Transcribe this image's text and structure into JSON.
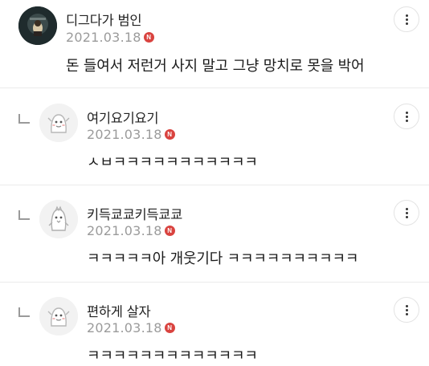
{
  "comments": [
    {
      "nickname": "디그다가 범인",
      "date": "2021.03.18",
      "badge": "N",
      "text": "돈 들여서 저런거 사지 말고 그냥 망치로 못을 박어",
      "avatar_icon": "profile-photo-icon",
      "is_reply": false
    },
    {
      "nickname": "여기요기요기",
      "date": "2021.03.18",
      "badge": "N",
      "text": "ㅅㅂㅋㅋㅋㅋㅋㅋㅋㅋㅋㅋㅋ",
      "avatar_icon": "default-character-icon",
      "is_reply": true
    },
    {
      "nickname": "키득쿄쿄키득쿄쿄",
      "date": "2021.03.18",
      "badge": "N",
      "text": "ㅋㅋㅋㅋㅋ아 개웃기다 ㅋㅋㅋㅋㅋㅋㅋㅋㅋㅋ",
      "avatar_icon": "penguin-character-icon",
      "is_reply": true
    },
    {
      "nickname": "편하게 살자",
      "date": "2021.03.18",
      "badge": "N",
      "text": "ㅋㅋㅋㅋㅋㅋㅋㅋㅋㅋㅋㅋㅋ",
      "avatar_icon": "default-character-icon",
      "is_reply": true
    }
  ],
  "icons": {
    "more": "more-vertical-icon",
    "reply": "reply-arrow-icon",
    "new_badge": "new-badge-icon"
  },
  "colors": {
    "badge": "#d9433f",
    "date": "#9b9b9b",
    "divider": "#ebebeb"
  }
}
